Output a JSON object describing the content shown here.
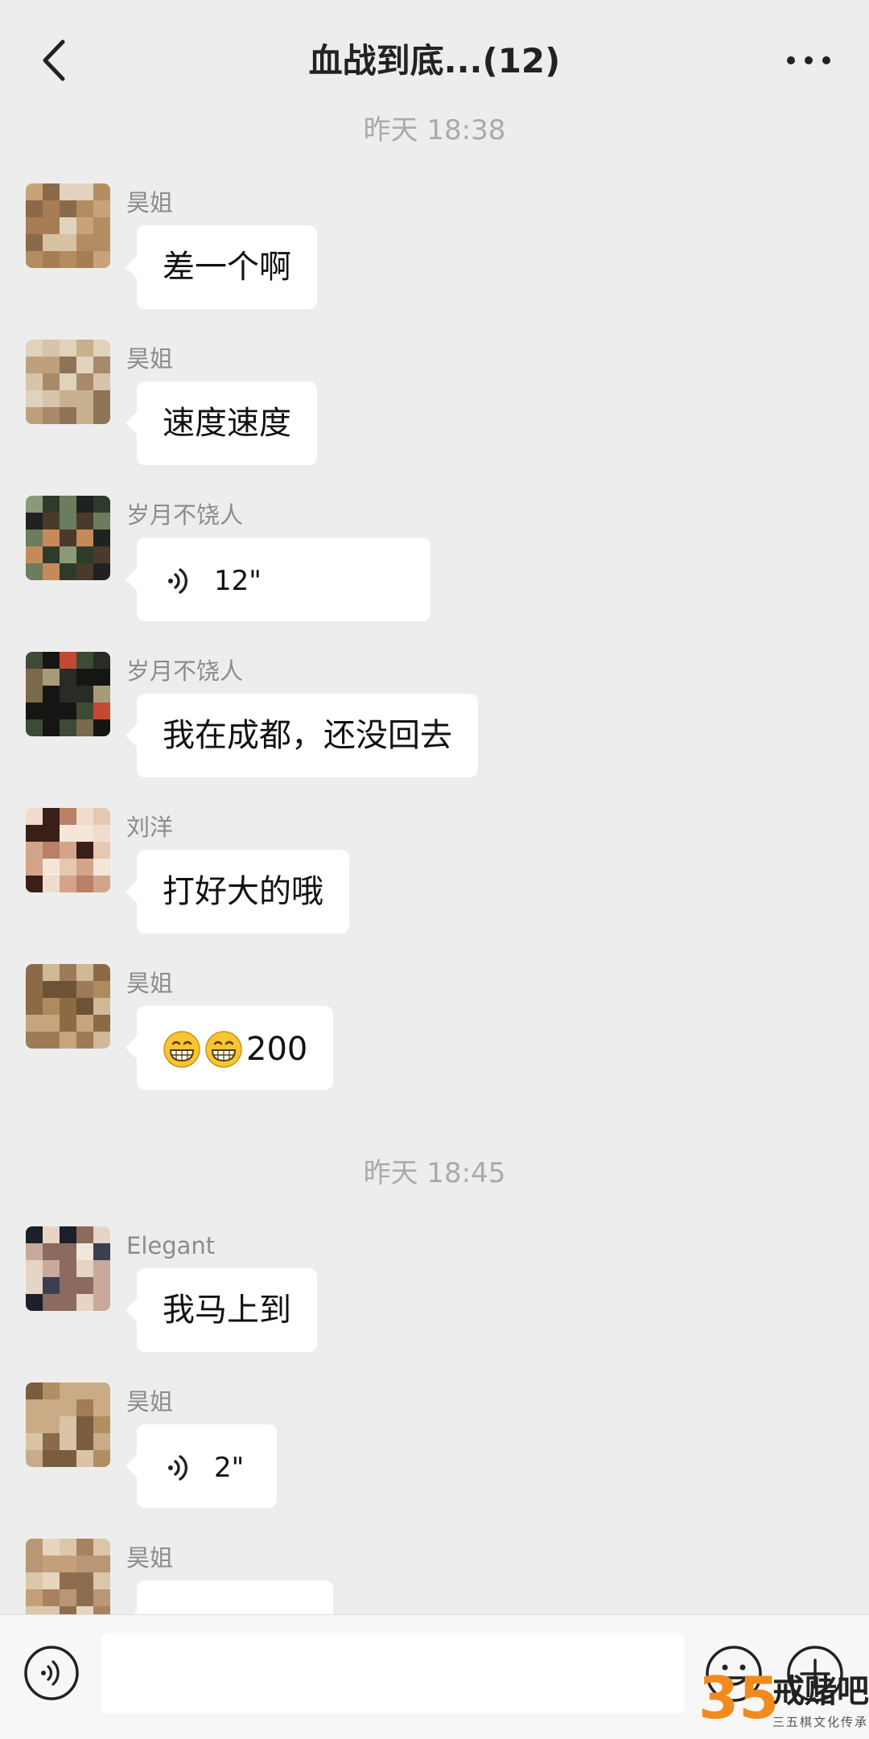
{
  "header": {
    "title": "血战到底...(12)",
    "back_icon": "chevron-left-icon",
    "more_icon": "ellipsis-icon"
  },
  "timestamps": [
    "昨天 18:38",
    "昨天 18:45"
  ],
  "messages": [
    {
      "sender": "昊姐",
      "text": "差一个啊"
    },
    {
      "sender": "昊姐",
      "text": "速度速度"
    },
    {
      "sender": "岁月不饶人",
      "type": "voice",
      "duration": "12\""
    },
    {
      "sender": "岁月不饶人",
      "text": "我在成都，还没回去"
    },
    {
      "sender": "刘洋",
      "text": "打好大的哦"
    },
    {
      "sender": "昊姐",
      "emoji": "grin-emoji",
      "text": "200"
    },
    {
      "sender": "Elegant",
      "text": "我马上到"
    },
    {
      "sender": "昊姐",
      "type": "voice",
      "duration": "2\""
    },
    {
      "sender": "昊姐",
      "text": ""
    }
  ],
  "input": {
    "value": "",
    "placeholder": ""
  },
  "toolbar": {
    "voice_icon": "voice-mode-icon",
    "emoji_icon": "smiley-icon",
    "plus_icon": "plus-icon"
  },
  "watermark": {
    "number": "35",
    "text": "戒赌吧",
    "subtext": "三五棋文化传承"
  },
  "colors": {
    "background": "#ededed",
    "bubble": "#ffffff",
    "timestamp": "#aaaaaa",
    "sender": "#8c8c8c",
    "watermark_orange": "#f28b1c"
  }
}
